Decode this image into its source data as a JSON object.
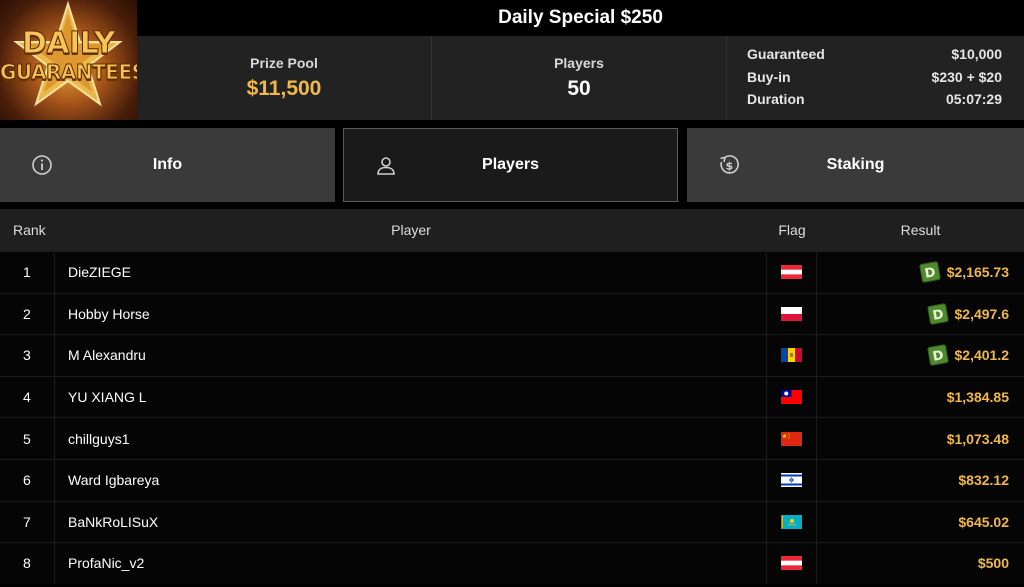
{
  "logo": {
    "line1": "DAILY",
    "line2": "GUARANTEES"
  },
  "title": "Daily Special $250",
  "stats": {
    "prize_pool_label": "Prize Pool",
    "prize_pool_value": "$11,500",
    "players_label": "Players",
    "players_value": "50",
    "details": [
      {
        "label": "Guaranteed",
        "value": "$10,000"
      },
      {
        "label": "Buy-in",
        "value": "$230 + $20"
      },
      {
        "label": "Duration",
        "value": "05:07:29"
      }
    ]
  },
  "tabs": [
    {
      "label": "Info",
      "icon": "info-icon"
    },
    {
      "label": "Players",
      "icon": "user-icon",
      "active": true
    },
    {
      "label": "Staking",
      "icon": "dollar-coin-icon"
    }
  ],
  "table": {
    "headers": {
      "rank": "Rank",
      "player": "Player",
      "flag": "Flag",
      "result": "Result"
    },
    "rows": [
      {
        "rank": "1",
        "player": "DieZIEGE",
        "flag": "austria",
        "badge": "D",
        "result": "$2,165.73"
      },
      {
        "rank": "2",
        "player": "Hobby Horse",
        "flag": "poland",
        "badge": "D",
        "result": "$2,497.6"
      },
      {
        "rank": "3",
        "player": "M Alexandru",
        "flag": "moldova",
        "badge": "D",
        "result": "$2,401.2"
      },
      {
        "rank": "4",
        "player": "YU XIANG L",
        "flag": "taiwan",
        "badge": "",
        "result": "$1,384.85"
      },
      {
        "rank": "5",
        "player": "chillguys1",
        "flag": "china",
        "badge": "",
        "result": "$1,073.48"
      },
      {
        "rank": "6",
        "player": "Ward Igbareya",
        "flag": "israel",
        "badge": "",
        "result": "$832.12"
      },
      {
        "rank": "7",
        "player": "BaNkRoLISuX",
        "flag": "kazakhstan",
        "badge": "",
        "result": "$645.02"
      },
      {
        "rank": "8",
        "player": "ProfaNic_v2",
        "flag": "austria",
        "badge": "",
        "result": "$500"
      }
    ]
  },
  "colors": {
    "gold": "#f0b84a",
    "badge_green": "#4f8a2e",
    "panel": "#222222",
    "tab": "#3a3a3a"
  }
}
